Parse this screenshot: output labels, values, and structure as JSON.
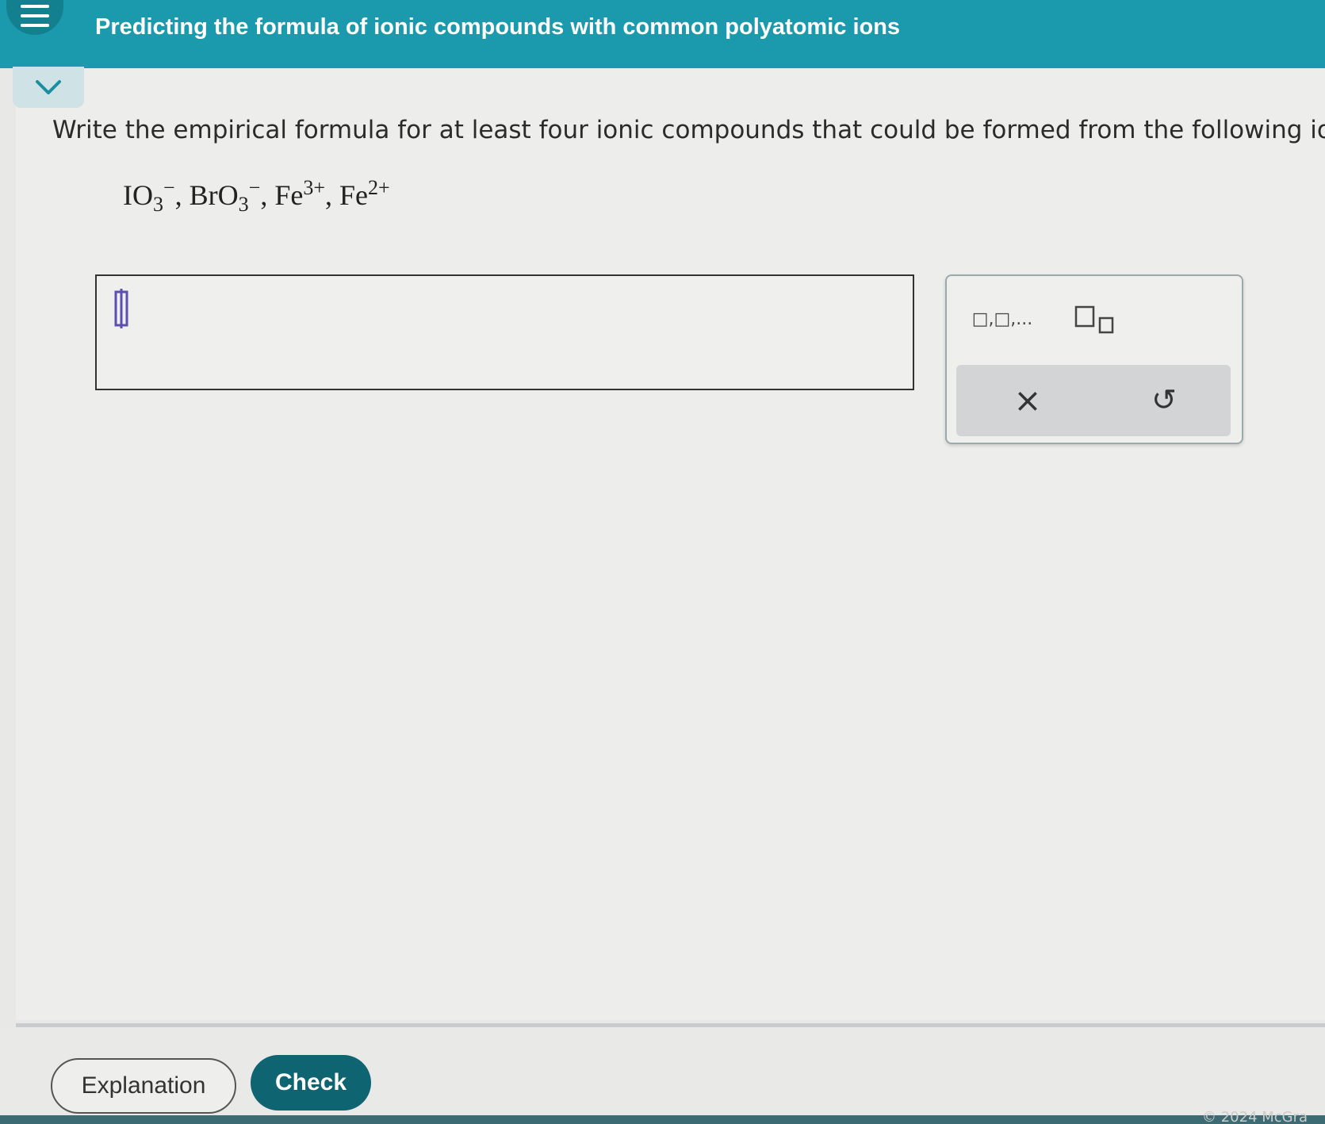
{
  "header": {
    "title": "Predicting the formula of ionic compounds with common polyatomic ions"
  },
  "question": {
    "prompt": "Write the empirical formula for at least four ionic compounds that could be formed from the following ions:",
    "ions": [
      {
        "base": "IO",
        "sub": "3",
        "sup": "−"
      },
      {
        "base": "BrO",
        "sub": "3",
        "sup": "−"
      },
      {
        "base": "Fe",
        "sub": "",
        "sup": "3+"
      },
      {
        "base": "Fe",
        "sub": "",
        "sup": "2+"
      }
    ],
    "separator": ","
  },
  "answer": {
    "value": ""
  },
  "tools": {
    "list_label": "□,□,...",
    "subscript_icon": "subscript-template-icon",
    "clear_symbol": "×",
    "undo_symbol": "↺"
  },
  "buttons": {
    "explanation_label": "Explanation",
    "check_label": "Check"
  },
  "footer": {
    "copyright": "© 2024 McGra"
  },
  "colors": {
    "header": "#1b9aad",
    "check_button": "#0e6470",
    "background": "#ededeb"
  }
}
